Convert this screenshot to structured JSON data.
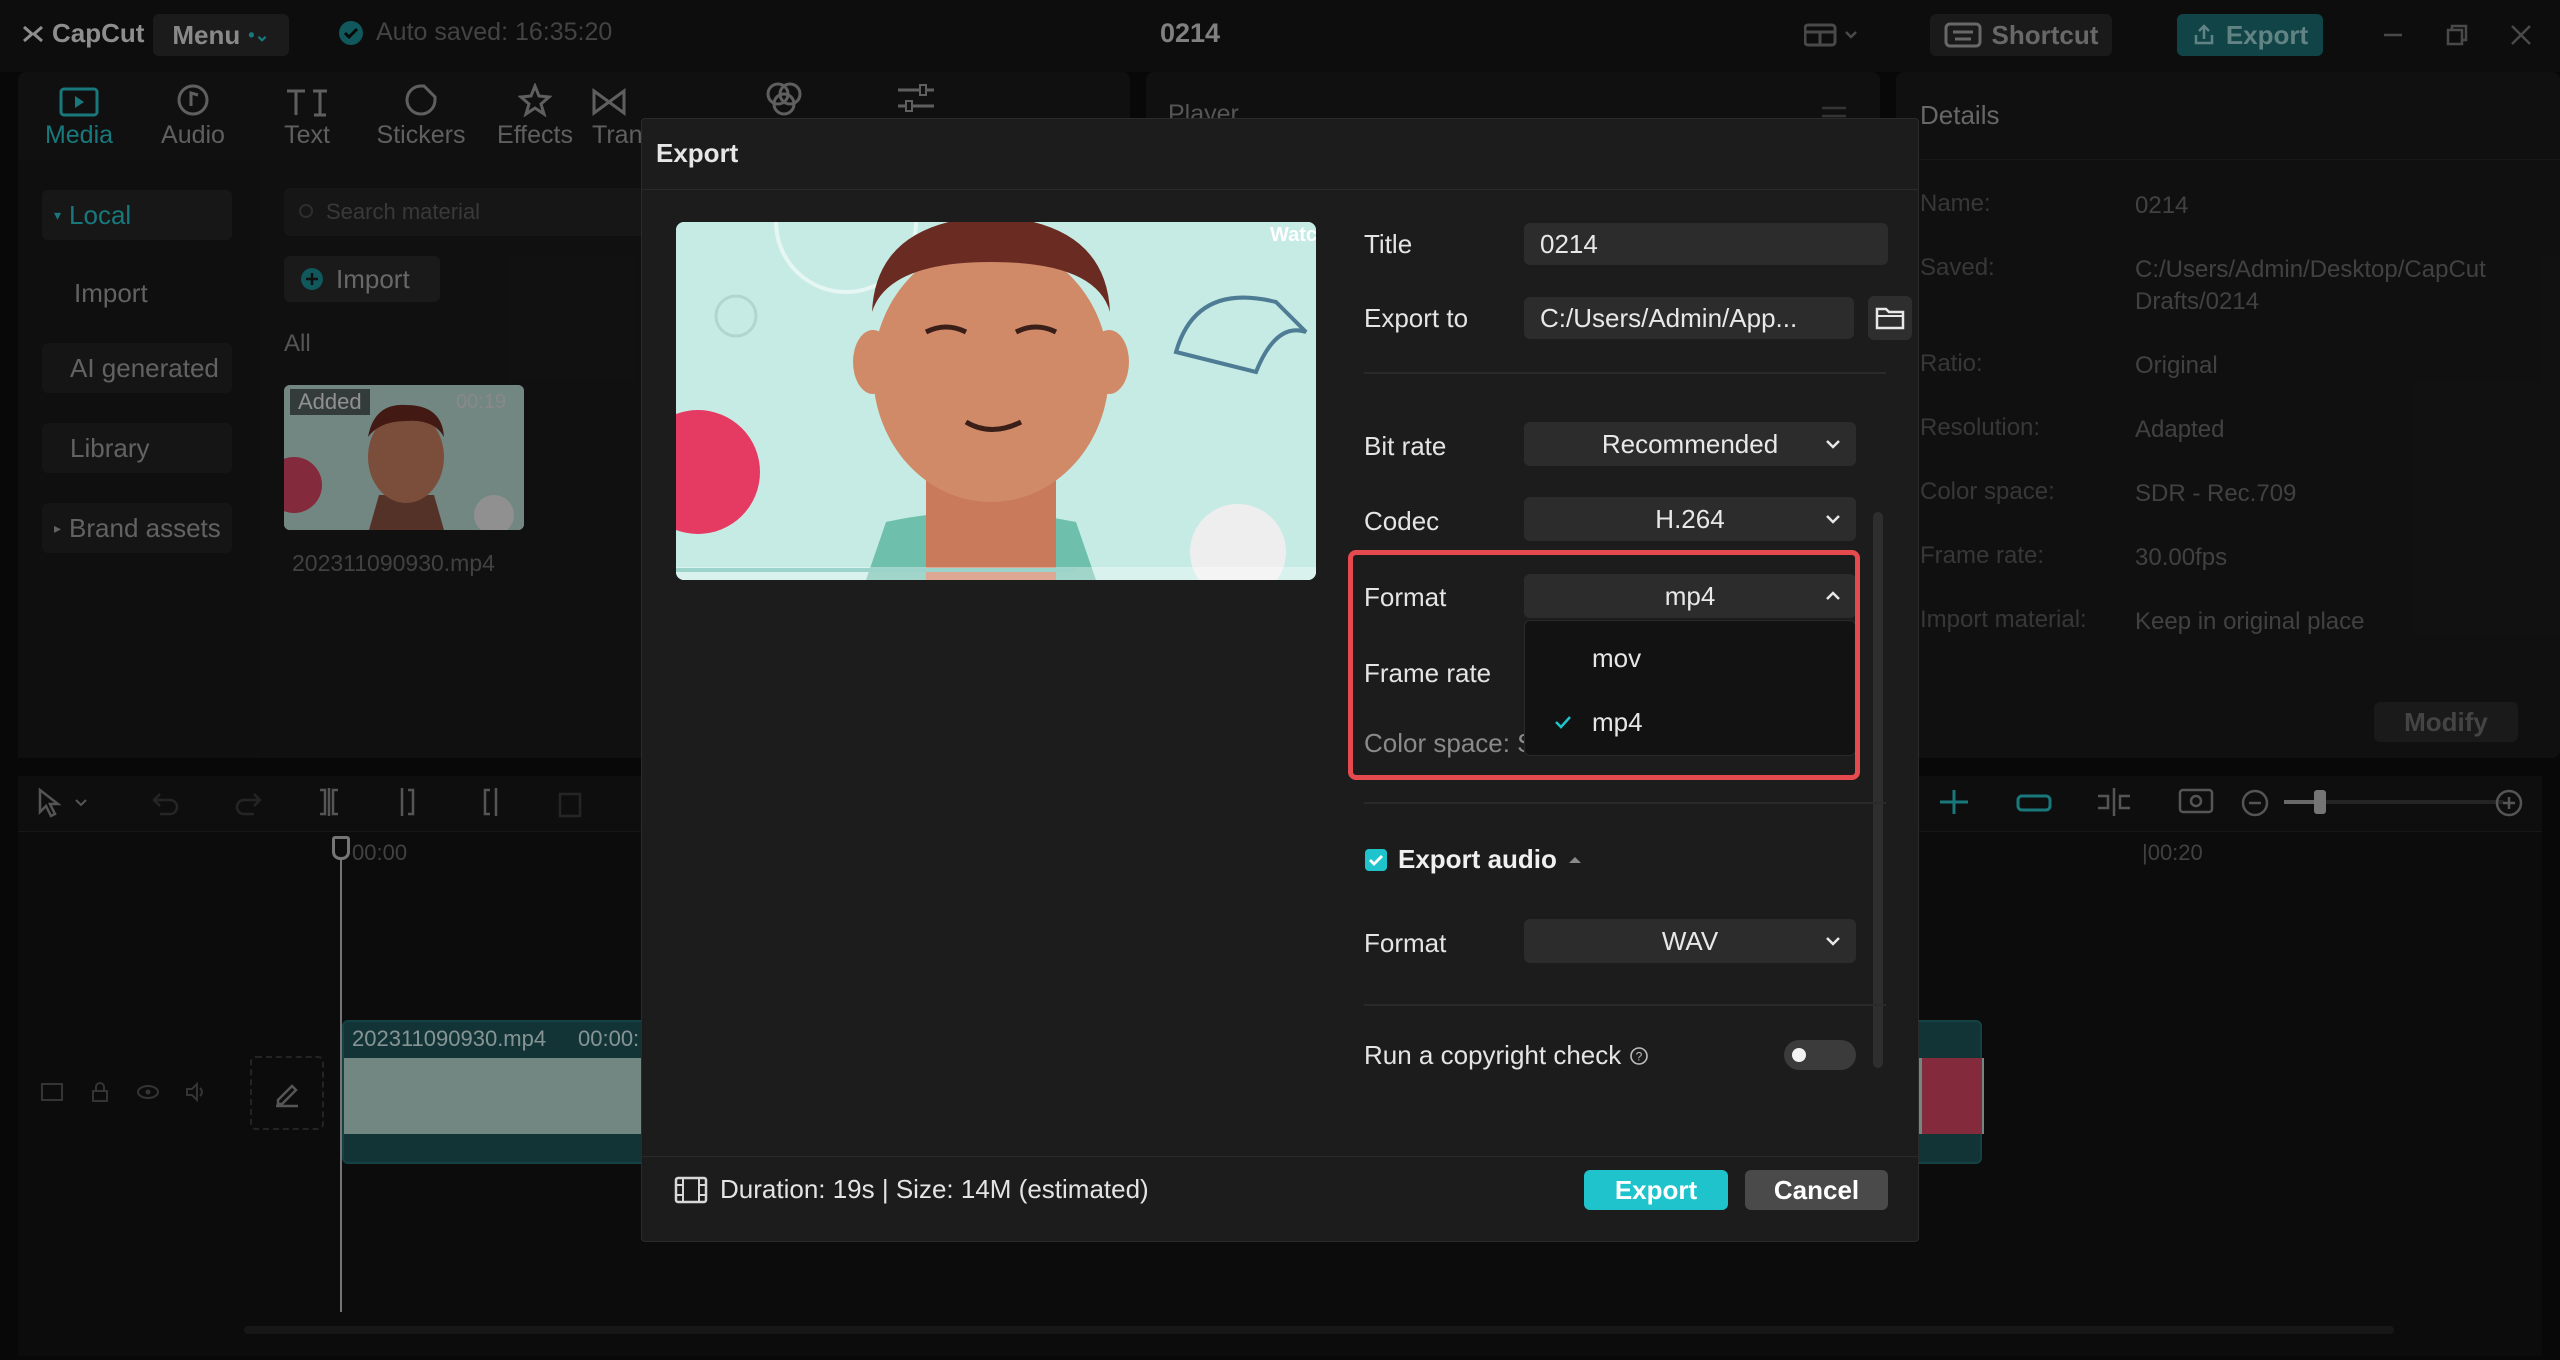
{
  "app": {
    "logo_text": "CapCut",
    "menu_label": "Menu",
    "autosave_text": "Auto saved: 16:35:20",
    "project_title": "0214",
    "shortcut_label": "Shortcut",
    "export_label": "Export"
  },
  "media_tabs": [
    {
      "label": "Media",
      "icon": "media-icon"
    },
    {
      "label": "Audio",
      "icon": "audio-icon"
    },
    {
      "label": "Text",
      "icon": "text-icon"
    },
    {
      "label": "Stickers",
      "icon": "stickers-icon"
    },
    {
      "label": "Effects",
      "icon": "effects-icon"
    },
    {
      "label": "Tran",
      "icon": "transitions-icon"
    }
  ],
  "sidebar": {
    "items": [
      {
        "label": "Local"
      },
      {
        "label": "Import"
      },
      {
        "label": "AI generated"
      },
      {
        "label": "Library"
      },
      {
        "label": "Brand assets"
      }
    ]
  },
  "media": {
    "search_placeholder": "Search material",
    "import_label": "Import",
    "filter_all": "All",
    "clip_badge": "Added",
    "clip_duration": "00:19",
    "clip_name": "202311090930.mp4"
  },
  "player": {
    "title": "Player"
  },
  "details": {
    "title": "Details",
    "rows": [
      {
        "label": "Name:",
        "value": "0214"
      },
      {
        "label": "Saved:",
        "value": "C:/Users/Admin/Desktop/CapCut Drafts/0214"
      },
      {
        "label": "Ratio:",
        "value": "Original"
      },
      {
        "label": "Resolution:",
        "value": "Adapted"
      },
      {
        "label": "Color space:",
        "value": "SDR - Rec.709"
      },
      {
        "label": "Frame rate:",
        "value": "30.00fps"
      },
      {
        "label": "Import material:",
        "value": "Keep in original place"
      }
    ],
    "modify_label": "Modify"
  },
  "timeline": {
    "time_start": "00:00",
    "time_20": "|00:20",
    "clip_name": "202311090930.mp4",
    "clip_time": "00:00:"
  },
  "export_dialog": {
    "title": "Export",
    "watermark_text": "Watc",
    "fields": {
      "title_label": "Title",
      "title_value": "0214",
      "export_to_label": "Export to",
      "export_to_value": "C:/Users/Admin/App...",
      "bitrate_label": "Bit rate",
      "bitrate_value": "Recommended",
      "codec_label": "Codec",
      "codec_value": "H.264",
      "format_label": "Format",
      "format_value": "mp4",
      "framerate_label": "Frame rate",
      "colorspace_label": "Color space: S"
    },
    "format_options": [
      {
        "label": "mov",
        "selected": false
      },
      {
        "label": "mp4",
        "selected": true
      }
    ],
    "audio": {
      "export_audio_label": "Export audio",
      "export_audio_checked": true,
      "format_label": "Format",
      "format_value": "WAV"
    },
    "copyright_label": "Run a copyright check",
    "copyright_enabled": false,
    "duration_text": "Duration: 19s | Size: 14M (estimated)",
    "export_button": "Export",
    "cancel_button": "Cancel"
  },
  "colors": {
    "accent": "#1ec3cc",
    "highlight": "#e54a4f",
    "dialog_bg": "#1c1c1c"
  }
}
